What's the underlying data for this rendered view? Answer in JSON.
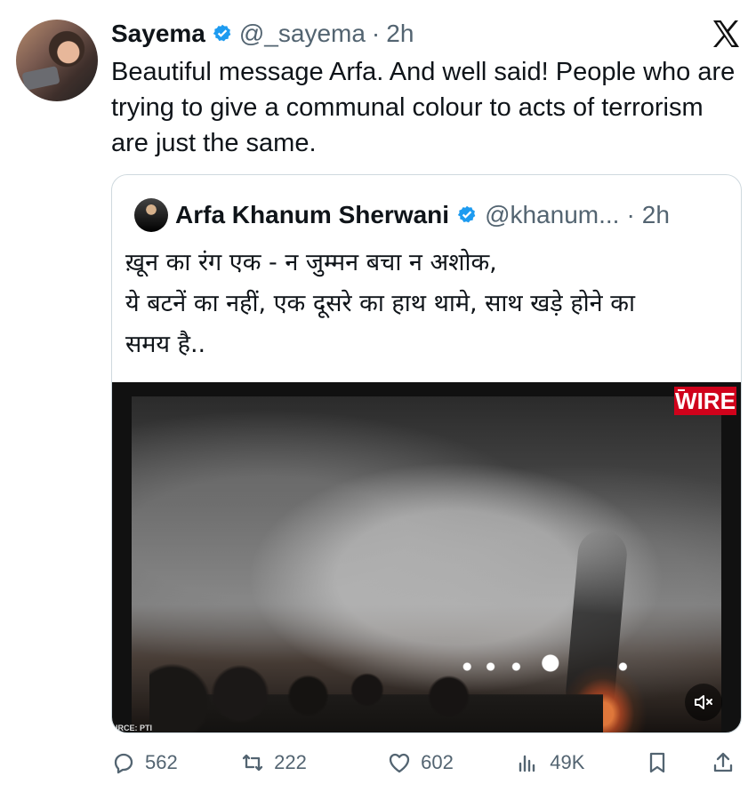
{
  "post": {
    "author_name": "Sayema",
    "handle": "@_sayema",
    "separator": "·",
    "time": "2h",
    "text": "Beautiful message Arfa. And well said! People who are trying to give a communal colour to acts of terrorism are just the same."
  },
  "quoted_post": {
    "author_name": "Arfa Khanum Sherwani",
    "handle": "@khanum...",
    "separator": "·",
    "time": "2h",
    "text_lines": [
      "ख़ून का रंग एक - न जुम्मन बचा न अशोक,",
      "ये बटनें का नहीं, एक दूसरे का हाथ थामे, साथ खड़े होने का",
      "समय है.."
    ],
    "media": {
      "logo_text": "WIRE",
      "source_text": "URCE: PTI",
      "mute_icon": "volume-muted-icon"
    }
  },
  "actions": {
    "reply_count": "562",
    "repost_count": "222",
    "like_count": "602",
    "views_count": "49K"
  },
  "icons": {
    "verified": "verified-badge-icon",
    "x_logo": "x-logo-icon",
    "reply": "comment-icon",
    "repost": "repost-icon",
    "like": "heart-icon",
    "views": "analytics-icon",
    "bookmark": "bookmark-icon",
    "share": "share-icon"
  },
  "colors": {
    "verified": "#1d9bf0",
    "secondary_text": "#536471",
    "wire_red": "#d0021b"
  }
}
